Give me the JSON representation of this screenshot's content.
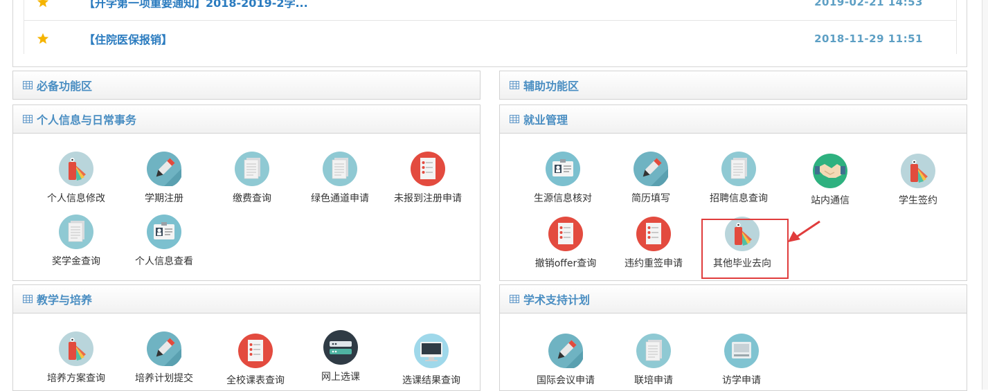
{
  "notices": [
    {
      "title": "【开学第一项重要通知】2018-2019-2学...",
      "time": "2019-02-21 14:53"
    },
    {
      "title": "【住院医保报销】",
      "time": "2018-11-29 11:51"
    }
  ],
  "sections": {
    "required": {
      "title": "必备功能区"
    },
    "auxiliary": {
      "title": "辅助功能区"
    },
    "personal": {
      "title": "个人信息与日常事务",
      "items": [
        {
          "label": "个人信息修改",
          "icon": "tag-swatch-icon"
        },
        {
          "label": "学期注册",
          "icon": "pen-icon"
        },
        {
          "label": "缴费查询",
          "icon": "documents-icon"
        },
        {
          "label": "绿色通道申请",
          "icon": "documents-icon"
        },
        {
          "label": "未报到注册申请",
          "icon": "checklist-icon"
        },
        {
          "label": "奖学金查询",
          "icon": "documents-icon"
        },
        {
          "label": "个人信息查看",
          "icon": "id-card-icon"
        }
      ]
    },
    "employment": {
      "title": "就业管理",
      "items": [
        {
          "label": "生源信息核对",
          "icon": "id-card-icon"
        },
        {
          "label": "简历填写",
          "icon": "pen-icon"
        },
        {
          "label": "招聘信息查询",
          "icon": "documents-icon"
        },
        {
          "label": "站内通信",
          "icon": "handshake-icon"
        },
        {
          "label": "学生签约",
          "icon": "tag-swatch-icon"
        },
        {
          "label": "撤销offer查询",
          "icon": "checklist-icon"
        },
        {
          "label": "违约重签申请",
          "icon": "checklist-icon"
        },
        {
          "label": "其他毕业去向",
          "icon": "tag-swatch-icon"
        }
      ]
    },
    "teaching": {
      "title": "教学与培养",
      "items": [
        {
          "label": "培养方案查询",
          "icon": "tag-swatch-icon"
        },
        {
          "label": "培养计划提交",
          "icon": "pen-icon"
        },
        {
          "label": "全校课表查询",
          "icon": "checklist-icon"
        },
        {
          "label": "网上选课",
          "icon": "router-icon"
        },
        {
          "label": "选课结果查询",
          "icon": "monitor-icon"
        }
      ]
    },
    "academic": {
      "title": "学术支持计划",
      "items": [
        {
          "label": "国际会议申请",
          "icon": "pen-icon"
        },
        {
          "label": "联培申请",
          "icon": "documents-icon"
        },
        {
          "label": "访学申请",
          "icon": "printer-icon"
        }
      ]
    }
  },
  "colors": {
    "title_blue": "#4a8ec2",
    "link_blue": "#2a7bbf",
    "time_blue": "#5d9fc4",
    "highlight_red": "#e03c3c",
    "star": "#f5b400"
  }
}
